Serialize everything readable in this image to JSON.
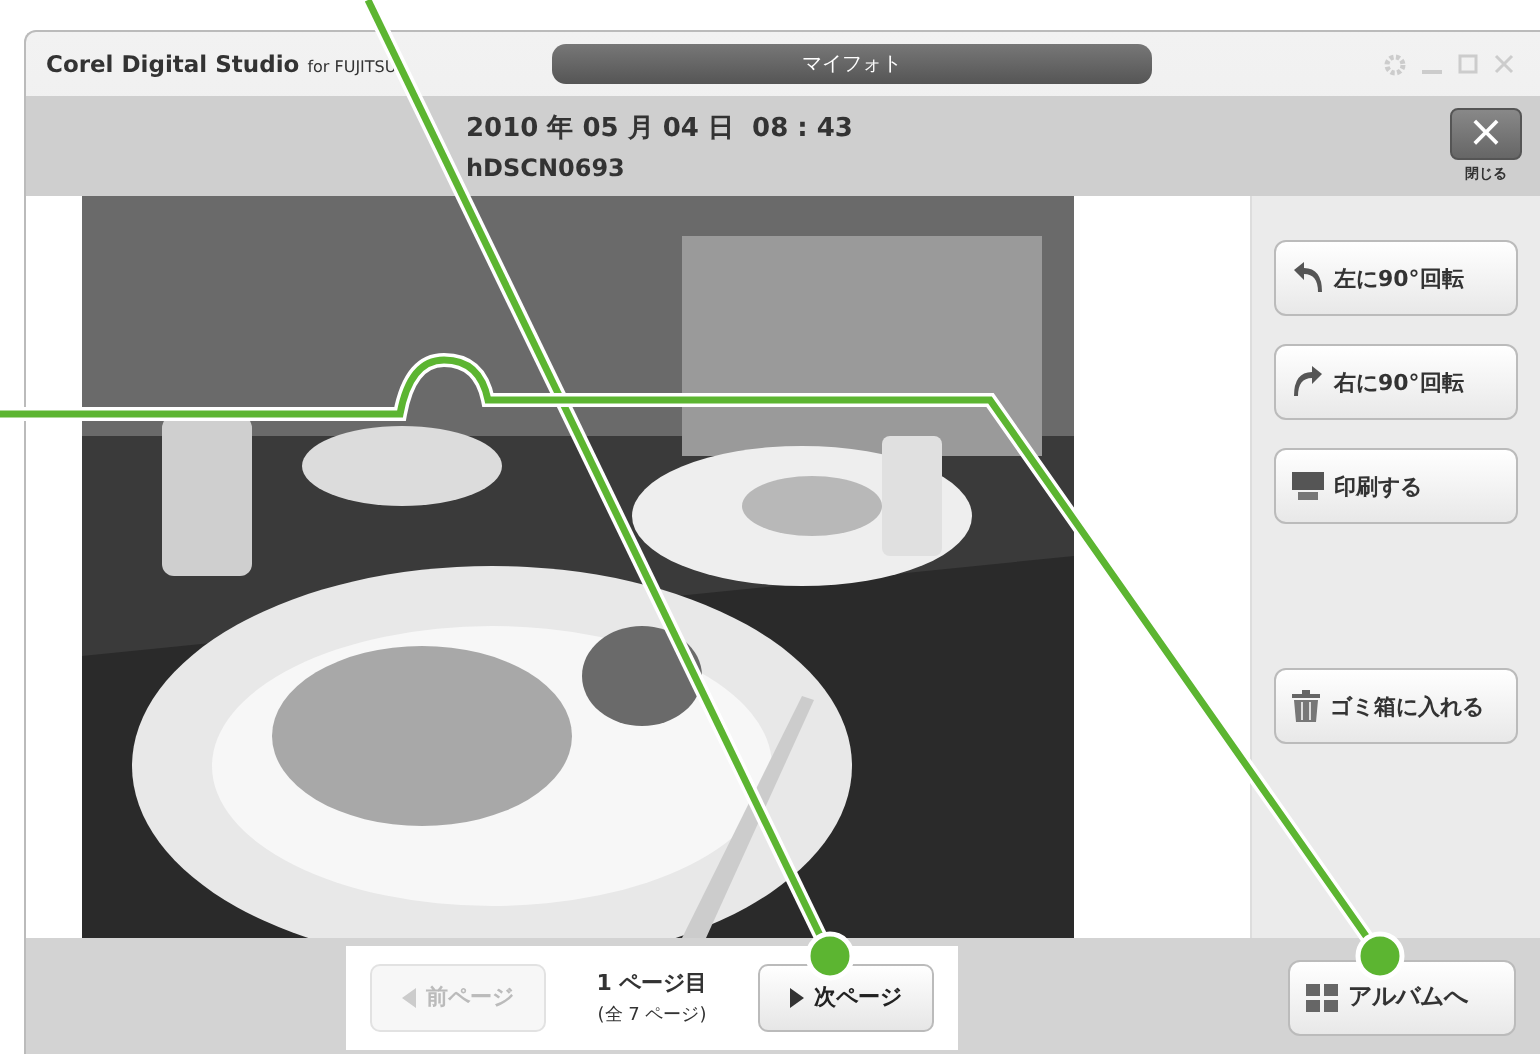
{
  "window": {
    "title": "Corel Digital Studio",
    "title_suffix": "for FUJITSU",
    "tab": "マイフォト"
  },
  "header": {
    "datetime": "2010 年 05 月 04 日  08 : 43",
    "filename": "hDSCN0693",
    "close_icon": "×",
    "close_label": "閉じる"
  },
  "side_buttons": [
    {
      "kind": "rotate-left",
      "label": "左に90°回転"
    },
    {
      "kind": "rotate-right",
      "label": "右に90°回転"
    },
    {
      "kind": "print",
      "label": "印刷する"
    },
    {
      "kind": "trash",
      "label": "ゴミ箱に入れる"
    }
  ],
  "pager": {
    "prev": {
      "label": "前ページ",
      "disabled": true
    },
    "current": "1 ページ目",
    "total": "(全 7 ページ)",
    "next": {
      "label": "次ページ",
      "disabled": false
    }
  },
  "album_button": "アルバムへ"
}
